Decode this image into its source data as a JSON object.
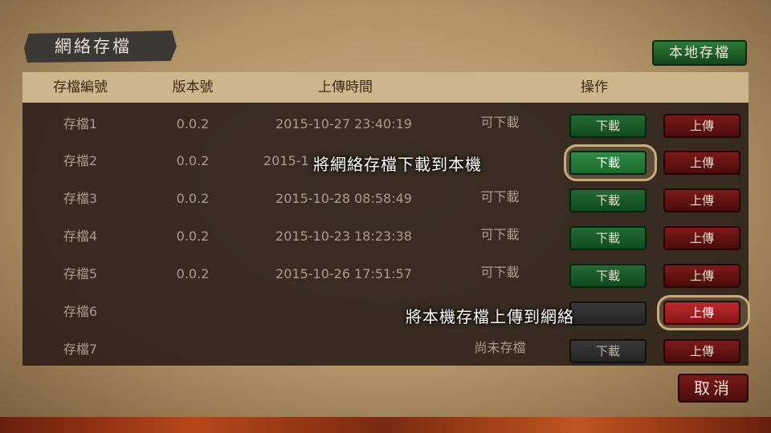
{
  "title": "網絡存檔",
  "local_save_button": "本地存檔",
  "cancel_button": "取消",
  "headers": {
    "slot": "存檔編號",
    "version": "版本號",
    "upload_time": "上傳時間",
    "action": "操作"
  },
  "rows": [
    {
      "slot": "存檔1",
      "version": "0.0.2",
      "time": "2015-10-27 23:40:19",
      "status": "可下載",
      "download": "下載",
      "upload": "上傳"
    },
    {
      "slot": "存檔2",
      "version": "0.0.2",
      "time": "2015-1",
      "status": "",
      "download": "下載",
      "upload": "上傳"
    },
    {
      "slot": "存檔3",
      "version": "0.0.2",
      "time": "2015-10-28 08:58:49",
      "status": "可下載",
      "download": "下載",
      "upload": "上傳"
    },
    {
      "slot": "存檔4",
      "version": "0.0.2",
      "time": "2015-10-23 18:23:38",
      "status": "可下載",
      "download": "下載",
      "upload": "上傳"
    },
    {
      "slot": "存檔5",
      "version": "0.0.2",
      "time": "2015-10-26 17:51:57",
      "status": "可下載",
      "download": "下載",
      "upload": "上傳"
    },
    {
      "slot": "存檔6",
      "version": "",
      "time": "",
      "status": "",
      "download": "",
      "upload": "上傳"
    },
    {
      "slot": "存檔7",
      "version": "",
      "time": "",
      "status": "尚未存檔",
      "download": "下載",
      "upload": "上傳"
    }
  ],
  "tips": {
    "download_tip": "將網絡存檔下載到本機",
    "upload_tip": "將本機存檔上傳到網絡"
  }
}
